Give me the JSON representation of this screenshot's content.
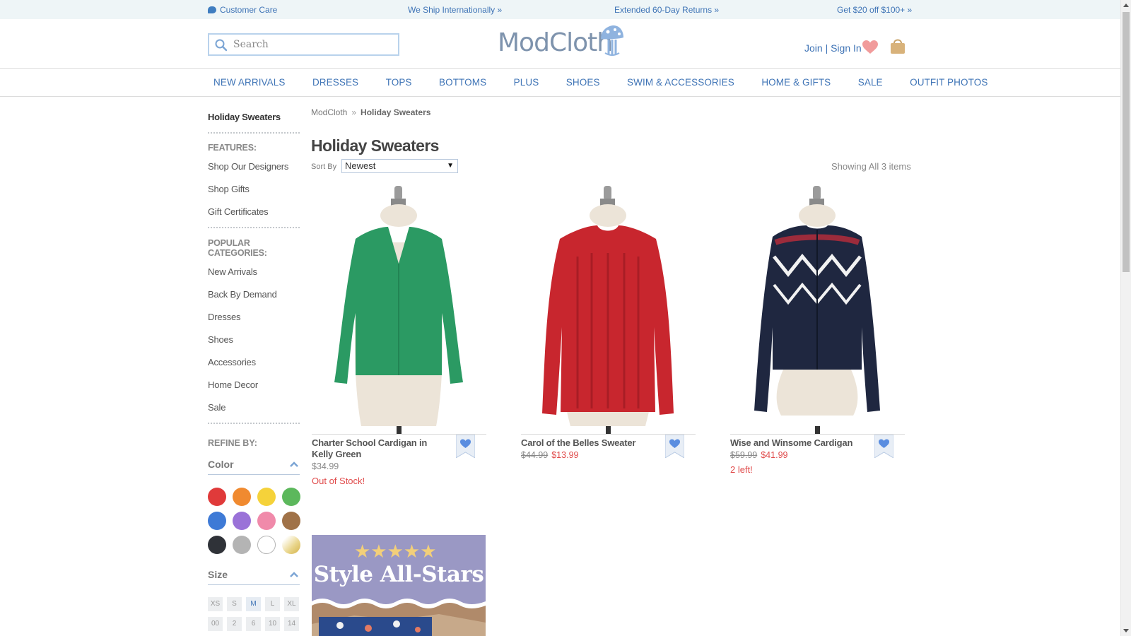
{
  "promo": {
    "customer_care": "Customer Care",
    "ship": "We Ship Internationally »",
    "returns": "Extended 60-Day Returns »",
    "offer": "Get $20 off $100+ »"
  },
  "header": {
    "search_placeholder": "Search",
    "logo_text": "ModCloth",
    "account_link": "Join | Sign In"
  },
  "nav": [
    "NEW ARRIVALS",
    "DRESSES",
    "TOPS",
    "BOTTOMS",
    "PLUS",
    "SHOES",
    "SWIM & ACCESSORIES",
    "HOME & GIFTS",
    "SALE",
    "OUTFIT PHOTOS"
  ],
  "sidebar": {
    "current": "Holiday Sweaters",
    "features_heading": "FEATURES:",
    "features": [
      "Shop Our Designers",
      "Shop Gifts",
      "Gift Certificates"
    ],
    "popular_heading": "POPULAR CATEGORIES:",
    "popular": [
      "New Arrivals",
      "Back By Demand",
      "Dresses",
      "Shoes",
      "Accessories",
      "Home Decor",
      "Sale"
    ],
    "refine_heading": "REFINE BY:",
    "color_heading": "Color",
    "colors": [
      "#e03a3a",
      "#f08a30",
      "#f5d23a",
      "#5cb85c",
      "#3e7ad6",
      "#9a72d8",
      "#f08aaa",
      "#a07248",
      "#2f3238",
      "#b4b4b4",
      "#ffffff",
      "#e9d58a"
    ],
    "size_heading": "Size",
    "sizes": [
      "XS",
      "S",
      "M",
      "L",
      "XL"
    ],
    "sizes_row2": [
      "00",
      "2",
      "6",
      "10",
      "14"
    ],
    "selected_size": "M"
  },
  "main": {
    "breadcrumb_root": "ModCloth",
    "breadcrumb_sep": "»",
    "breadcrumb_current": "Holiday Sweaters",
    "title": "Holiday Sweaters",
    "sort_label": "Sort By",
    "sort_value": "Newest",
    "showing": "Showing All 3 items"
  },
  "products": [
    {
      "name": "Charter School Cardigan in Kelly Green",
      "price": "$34.99",
      "old_price": "",
      "sale_price": "",
      "stock": "Out of Stock!",
      "color": "#2b9a63"
    },
    {
      "name": "Carol of the Belles Sweater",
      "price": "",
      "old_price": "$44.99",
      "sale_price": "$13.99",
      "stock": "",
      "color": "#c8262e"
    },
    {
      "name": "Wise and Winsome Cardigan",
      "price": "",
      "old_price": "$59.99",
      "sale_price": "$41.99",
      "stock": "2 left!",
      "color": "#1f2740"
    }
  ],
  "banner": {
    "stars": "★★★★★",
    "title": "Style All-Stars"
  }
}
